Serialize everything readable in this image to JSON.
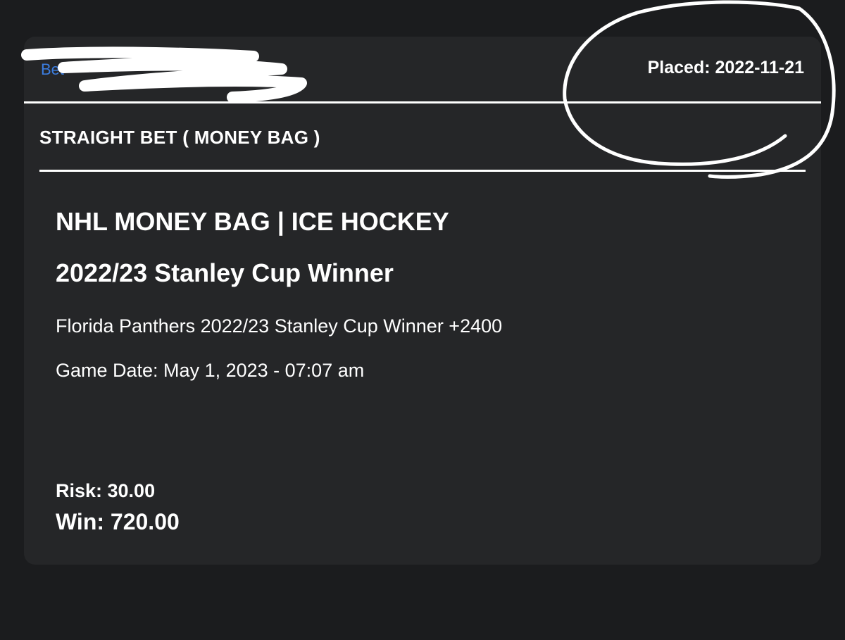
{
  "ticket": {
    "placed_label": "Placed: 2022-11-21",
    "bet_type": "STRAIGHT BET ( MONEY BAG )",
    "league": "NHL MONEY BAG | ICE HOCKEY",
    "market": "2022/23 Stanley Cup Winner",
    "selection": "Florida Panthers 2022/23 Stanley Cup Winner +2400",
    "game_date": "Game Date: May 1, 2023 - 07:07 am",
    "risk": "Risk: 30.00",
    "win": "Win: 720.00"
  },
  "colors": {
    "page_background": "#1b1c1e",
    "card_background": "#252628",
    "link_blue": "#3b7de0",
    "text": "#ffffff"
  },
  "annotations": {
    "scribble": "redaction-scribble",
    "circle": "hand-drawn-circle"
  }
}
